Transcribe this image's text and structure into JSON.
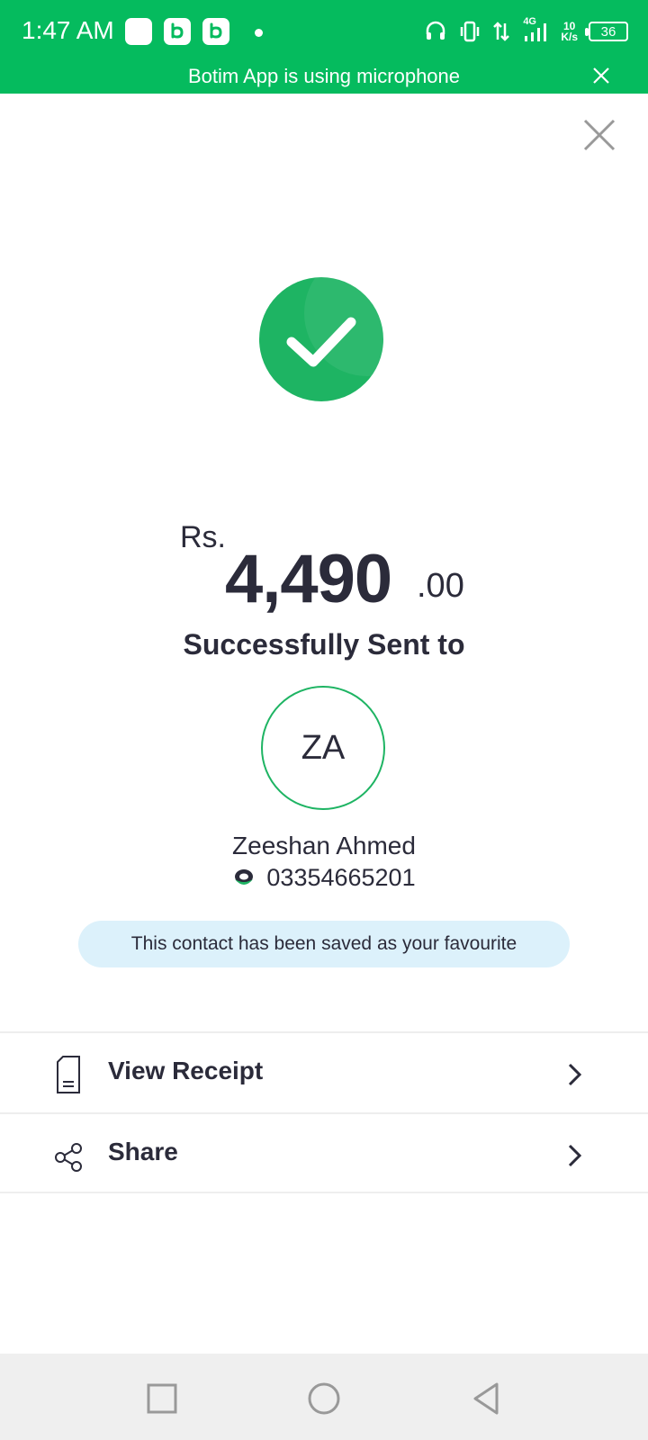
{
  "status_bar": {
    "time": "1:47 AM",
    "network": "4G",
    "speed_value": "10",
    "speed_unit": "K/s",
    "battery": "36",
    "color": "#05bb5e"
  },
  "mic_banner": {
    "text": "Botim App is using microphone"
  },
  "payment": {
    "currency": "Rs.",
    "amount_whole": "4,490",
    "amount_decimal": ".00",
    "status_text": "Successfully Sent to"
  },
  "recipient": {
    "initials": "ZA",
    "name": "Zeeshan Ahmed",
    "phone": "03354665201"
  },
  "favourite_notice": "This contact has been saved as your favourite",
  "actions": [
    {
      "label": "View Receipt",
      "icon": "receipt-icon"
    },
    {
      "label": "Share",
      "icon": "share-icon"
    }
  ],
  "nav": [
    "recent-apps",
    "home",
    "back"
  ],
  "colors": {
    "accent": "#1eb463",
    "notice_bg": "#dcf1fb",
    "text": "#2b2b3a"
  }
}
